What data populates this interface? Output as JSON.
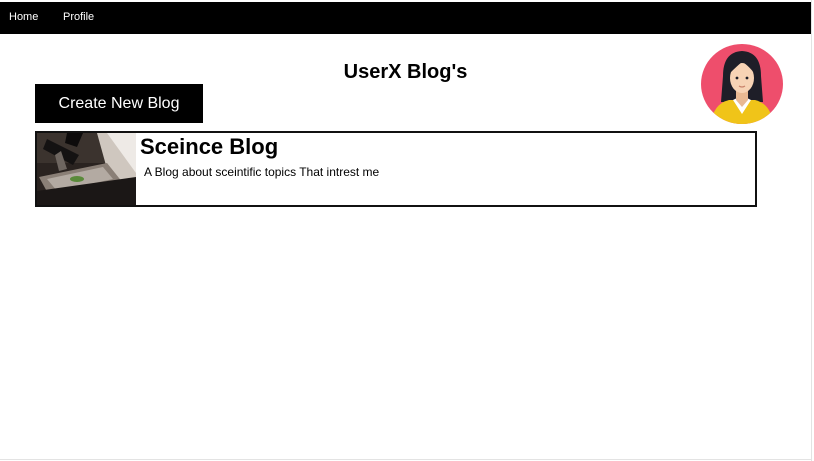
{
  "navbar": {
    "items": [
      {
        "label": "Home"
      },
      {
        "label": "Profile"
      }
    ]
  },
  "header": {
    "title": "UserX Blog's"
  },
  "actions": {
    "create_label": "Create New Blog"
  },
  "avatar": {
    "icon": "woman-avatar-icon",
    "colors": {
      "circle": "#ee4e6c",
      "hair": "#1e1e28",
      "skin": "#f7d3b5",
      "shirt": "#f0c419"
    }
  },
  "blogs": [
    {
      "title": "Sceince Blog",
      "description": "A Blog about sceintific topics That intrest me",
      "thumbnail": "microscope-image"
    }
  ],
  "theme": {
    "navbar_bg": "#000000",
    "button_bg": "#000000",
    "text": "#000000"
  }
}
